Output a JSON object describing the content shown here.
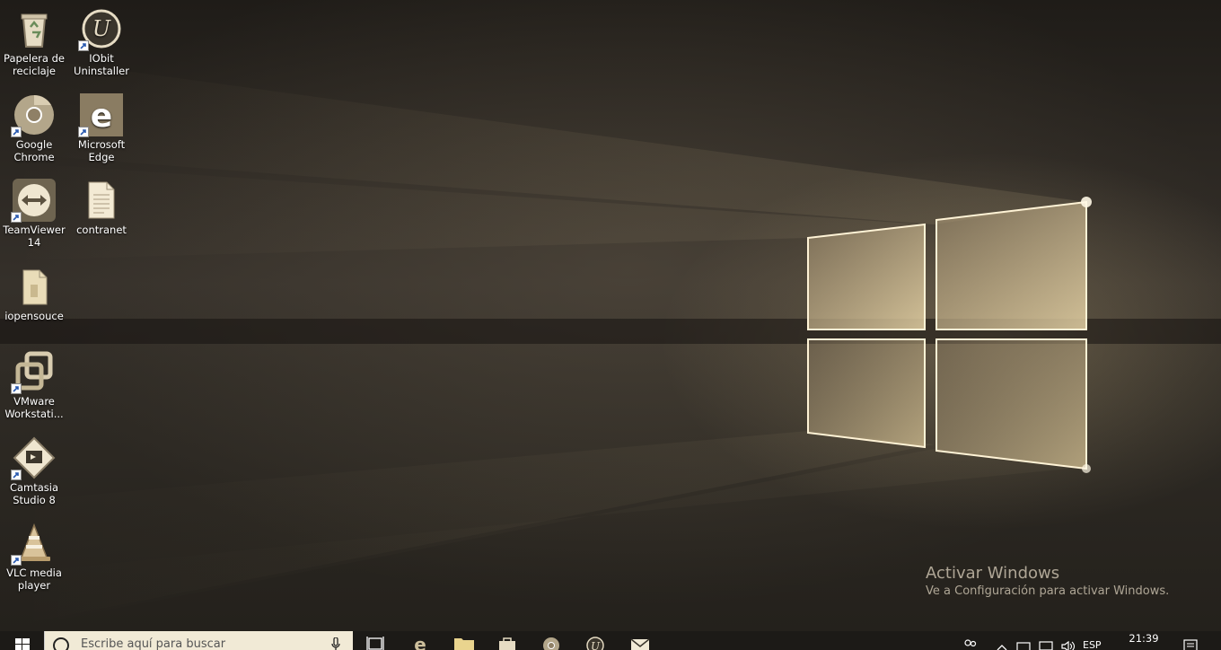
{
  "desktop": {
    "icons": [
      {
        "name": "recycle-bin",
        "label": "Papelera de reciclaje",
        "shortcut": false
      },
      {
        "name": "iobit-uninstaller",
        "label": "IObit Uninstaller",
        "shortcut": true
      },
      {
        "name": "google-chrome",
        "label": "Google Chrome",
        "shortcut": true
      },
      {
        "name": "microsoft-edge",
        "label": "Microsoft Edge",
        "shortcut": true
      },
      {
        "name": "teamviewer",
        "label": "TeamViewer 14",
        "shortcut": true
      },
      {
        "name": "contranet",
        "label": "contranet",
        "shortcut": false
      },
      {
        "name": "iopensouce",
        "label": "iopensouce",
        "shortcut": false
      },
      {
        "name": "vmware",
        "label": "VMware Workstati...",
        "shortcut": true
      },
      {
        "name": "camtasia",
        "label": "Camtasia Studio 8",
        "shortcut": true
      },
      {
        "name": "vlc",
        "label": "VLC media player",
        "shortcut": true
      }
    ]
  },
  "watermark": {
    "title": "Activar Windows",
    "subtitle": "Ve a Configuración para activar Windows."
  },
  "taskbar": {
    "search_placeholder": "Escribe aquí para buscar",
    "pinned": [
      "task-view",
      "edge",
      "file-explorer",
      "store",
      "chrome",
      "iobit",
      "mail"
    ],
    "tray": {
      "language": "ESP",
      "time": "21:39"
    }
  },
  "colors": {
    "tint": "#d6be8c",
    "taskbar": "#1c1a17",
    "search_bg": "#f1ead6"
  }
}
